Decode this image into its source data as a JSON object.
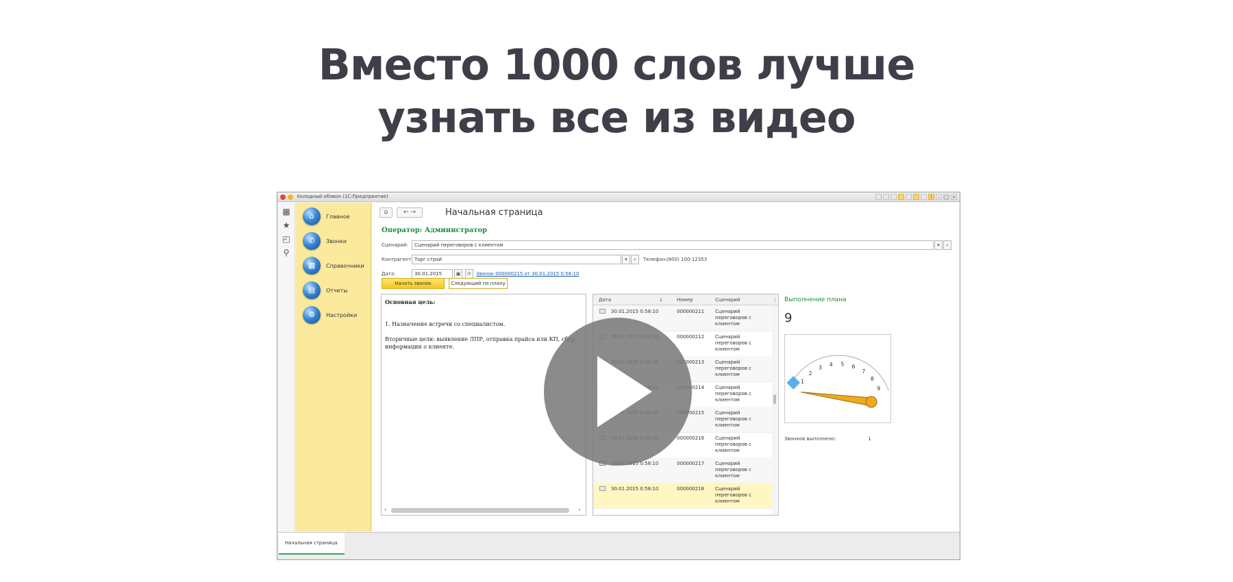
{
  "headline": {
    "line1": "Вместо 1000 слов лучше",
    "line2": "узнать все из видео"
  },
  "video_play_label": "play-icon",
  "app": {
    "window_title": "Холодный обзвон (1С:Предприятие)",
    "nav_items": [
      {
        "label": "Главное",
        "icon": "home-orb-icon"
      },
      {
        "label": "Звонки",
        "icon": "phone-orb-icon"
      },
      {
        "label": "Справочники",
        "icon": "grid-orb-icon"
      },
      {
        "label": "Отчеты",
        "icon": "report-orb-icon"
      },
      {
        "label": "Настройки",
        "icon": "settings-orb-icon"
      }
    ],
    "page_title": "Начальная страница",
    "operator": "Оператор: Администратор",
    "form": {
      "scenario_label": "Сценарий:",
      "scenario_value": "Сценарий переговоров с клиентом",
      "counterparty_label": "Контрагент:",
      "counterparty_value": "Торг строй",
      "phone_label": "Телефон:",
      "phone_value": "(800) 100-12353",
      "date_label": "Дата:",
      "date_value": "30.01.2015",
      "call_link": "Звонок 000000215 от 30.01.2015 0:58:10"
    },
    "buttons": {
      "start_call": "Начать звонок",
      "next_by_plan": "Следующий по плану"
    },
    "script_text": {
      "goal_title": "Основная цель:",
      "goal_item": "1. Назначение встречи со специалистом.",
      "secondary": "Вторичные цели: выявление ЛПР, отправка прайса или КП, сбор информации о клиенте."
    },
    "grid": {
      "columns": [
        "Дата",
        "Номер",
        "Сценарий"
      ],
      "rows": [
        {
          "date": "30.01.2015 0:58:10",
          "number": "000000211",
          "scenario": "Сценарий переговоров с клиентом",
          "status": "pending"
        },
        {
          "date": "30.01.2015 0:58:10",
          "number": "000000212",
          "scenario": "Сценарий переговоров с клиентом",
          "status": "pending"
        },
        {
          "date": "30.01.2015 0:58:10",
          "number": "000000213",
          "scenario": "Сценарий переговоров с клиентом",
          "status": "pending"
        },
        {
          "date": "30.01.2015 0:58:10",
          "number": "000000214",
          "scenario": "Сценарий переговоров с клиентом",
          "status": "pending"
        },
        {
          "date": "30.01.2015 0:58:10",
          "number": "000000215",
          "scenario": "Сценарий переговоров с клиентом",
          "status": "pending"
        },
        {
          "date": "30.01.2015 0:58:10",
          "number": "000000216",
          "scenario": "Сценарий переговоров с клиентом",
          "status": "pending"
        },
        {
          "date": "30.01.2015 0:58:10",
          "number": "000000217",
          "scenario": "Сценарий переговоров с клиентом",
          "status": "done"
        },
        {
          "date": "30.01.2015 0:58:10",
          "number": "000000218",
          "scenario": "Сценарий переговоров с клиентом",
          "status": "pending"
        }
      ]
    },
    "plan": {
      "label": "Выполнение плана",
      "count": "9",
      "gauge_ticks": [
        "1",
        "2",
        "3",
        "4",
        "5",
        "6",
        "7",
        "8",
        "9"
      ],
      "gauge_value": 1,
      "calls_done_label": "Звонков выполнено:",
      "calls_done_value": "1"
    },
    "bottom_tab": "Начальная страница"
  },
  "colors": {
    "headline": "#3f3f4a",
    "nav_panel": "#fbea9c",
    "accent_green": "#1f8a3c",
    "primary_button": "#f4c81e",
    "play_overlay": "#787878"
  }
}
